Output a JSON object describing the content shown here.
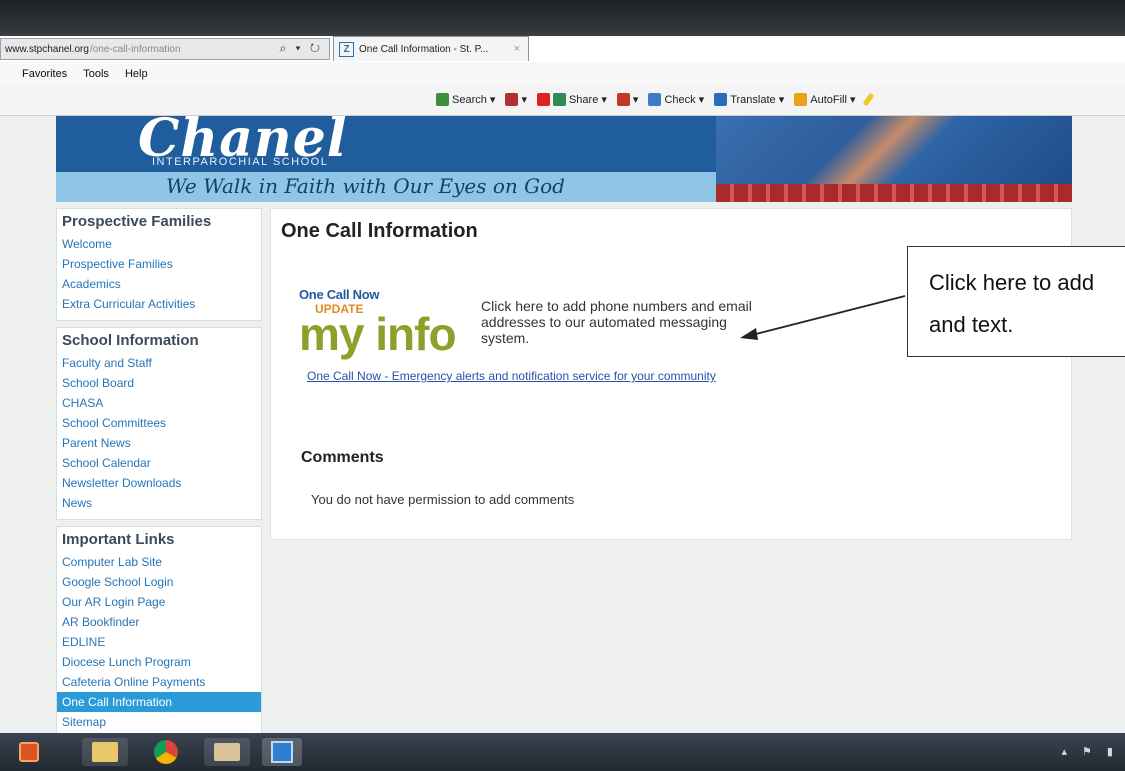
{
  "browser": {
    "url_domain": "www.stpchanel.org",
    "url_path": "/one-call-information",
    "nav_icons": "⌕ ▾ ↻",
    "tab_icon_letter": "Z",
    "tab_title": "One Call Information - St. P...",
    "tab_close": "×",
    "menu": [
      "Favorites",
      "Tools",
      "Help"
    ],
    "toolbar": {
      "search": "Search",
      "share": "Share",
      "check": "Check",
      "translate": "Translate",
      "autofill": "AutoFill"
    }
  },
  "banner": {
    "logo": "Chanel",
    "school": "INTERPAROCHIAL SCHOOL",
    "motto": "We Walk in Faith with Our Eyes on God"
  },
  "sidebar": {
    "prospective": {
      "heading": "Prospective Families",
      "items": [
        "Welcome",
        "Prospective Families",
        "Academics",
        "Extra Curricular Activities"
      ]
    },
    "school_info": {
      "heading": "School Information",
      "items": [
        "Faculty and Staff",
        "School Board",
        "CHASA",
        "School Committees",
        "Parent News",
        "School Calendar",
        "Newsletter Downloads",
        "News"
      ]
    },
    "links": {
      "heading": "Important Links",
      "items": [
        "Computer Lab Site",
        "Google School Login",
        "Our AR Login Page",
        "AR Bookfinder",
        "EDLINE",
        "Diocese Lunch Program",
        "Cafeteria Online Payments",
        "One Call Information",
        "Sitemap"
      ],
      "active": "One Call Information"
    }
  },
  "main": {
    "title": "One Call Information",
    "logo_brand": "One Call Now",
    "logo_update": "UPDATE",
    "logo_myinfo": "my info",
    "description": "Click here to add phone numbers and email addresses to our automated messaging system.",
    "link": "One Call Now - Emergency alerts and notification service for your community",
    "comments_heading": "Comments",
    "comments_permission": "You do not have permission to add comments"
  },
  "callout": {
    "line1": "Click here to add",
    "line2": "and text."
  },
  "colors": {
    "link_blue": "#2575b8",
    "active_blue": "#2a9bd8",
    "banner_blue": "#1f5d9c",
    "oc_green": "#8aa12a",
    "oc_orange": "#e28a1e"
  }
}
